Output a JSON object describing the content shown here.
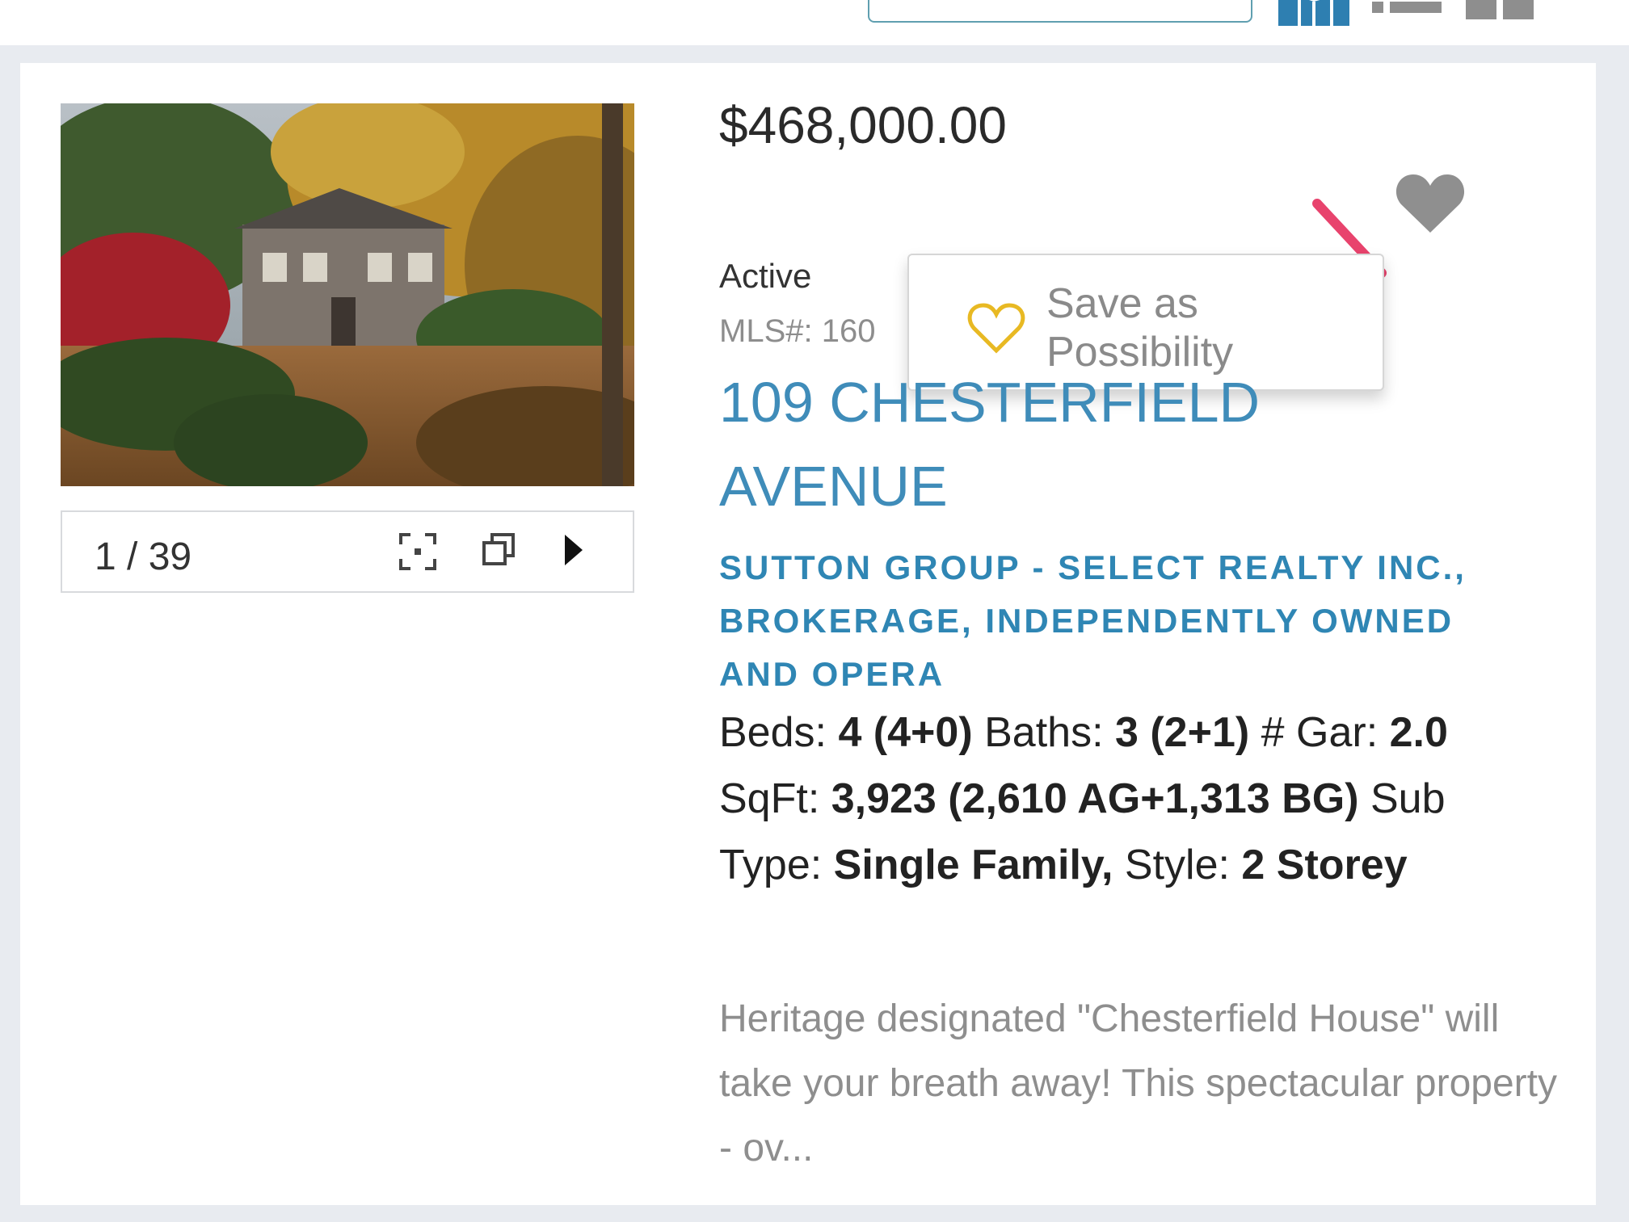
{
  "listing": {
    "price": "$468,000.00",
    "status": "Active",
    "mls": "MLS#: 160",
    "address_line1": "109 CHESTERFIELD",
    "address_line2": "AVENUE",
    "brokerage": "SUTTON GROUP - SELECT REALTY INC., BROKERAGE, INDEPENDENTLY OWNED AND OPERA",
    "specs": {
      "beds_label": "Beds:",
      "beds_value": "4 (4+0)",
      "baths_label": "Baths:",
      "baths_value": "3 (2+1)",
      "gar_label": "# Gar:",
      "gar_value": "2.0",
      "sqft_label": "SqFt:",
      "sqft_value": "3,923 (2,610 AG+1,313 BG)",
      "subtype_label": "Sub Type:",
      "subtype_value": "Single Family,",
      "style_label": "Style:",
      "style_value": "2 Storey"
    },
    "description": "Heritage designated \"Chesterfield House\" will take your breath away! This spectacular property - ov..."
  },
  "gallery": {
    "counter": "1 / 39"
  },
  "favorite_popup": {
    "label": "Save as Possibility"
  },
  "colors": {
    "link_blue": "#3f8cb9",
    "arrow_pink": "#e8436d",
    "heart_gray": "#8f8f8f",
    "heart_gold": "#e8b923"
  },
  "icons": {
    "toolbar": [
      "map-icon",
      "list-view-icon",
      "grid-view-icon"
    ],
    "gallery": [
      "fullscreen-icon",
      "popout-icon",
      "next-arrow-icon"
    ],
    "favorite": "heart-icon",
    "popup": "heart-outline-icon"
  }
}
